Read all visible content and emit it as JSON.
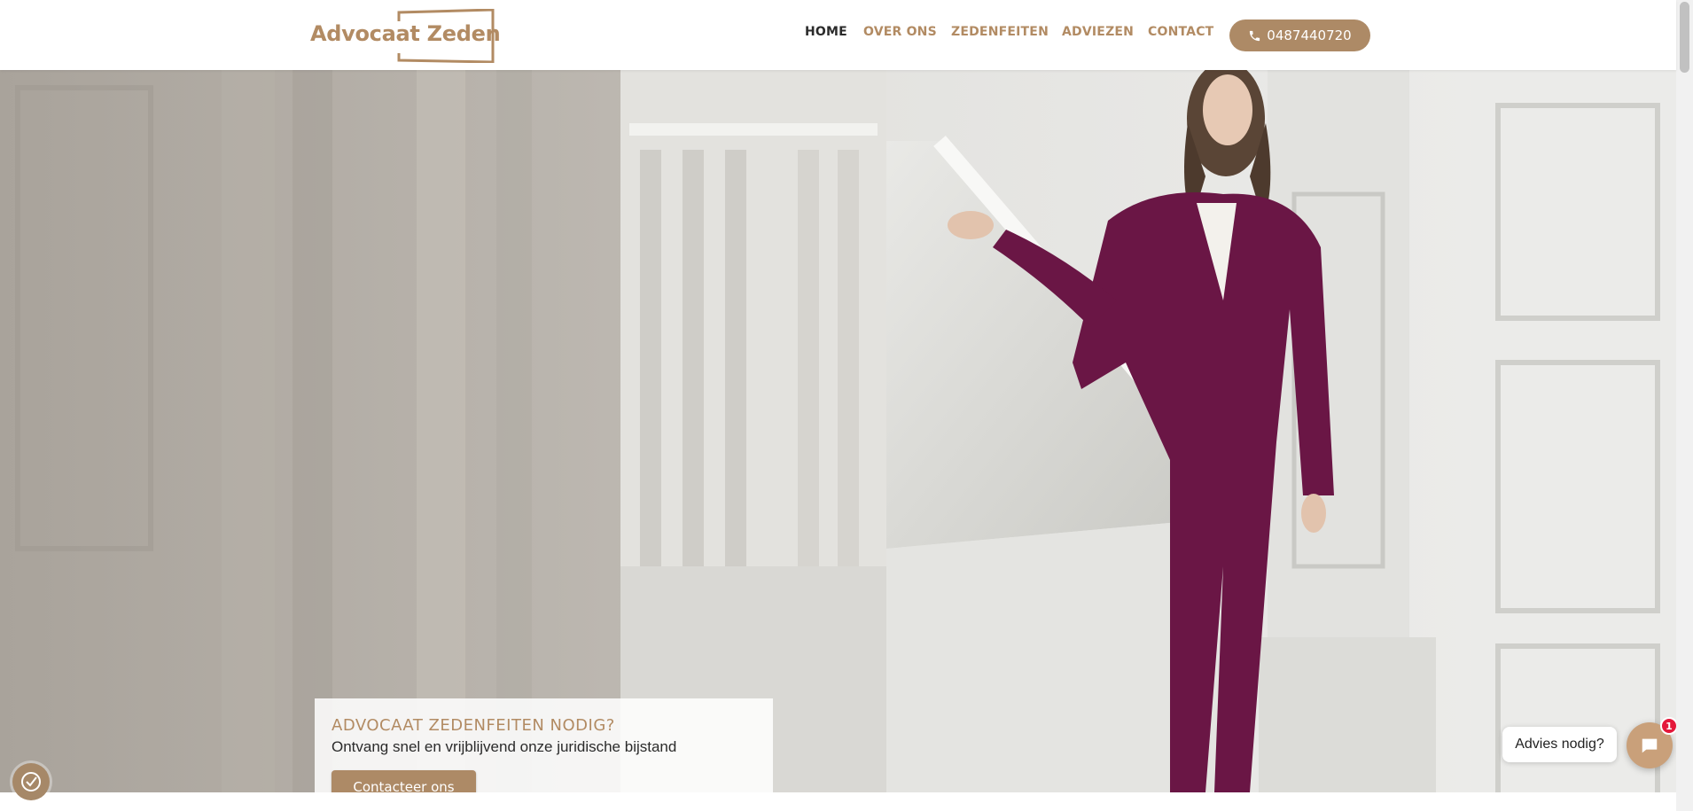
{
  "brand": {
    "logo_text": "Advocaat Zeden",
    "accent_color": "#b28b63"
  },
  "nav": {
    "items": [
      {
        "label": "HOME",
        "active": true
      },
      {
        "label": "OVER ONS",
        "active": false
      },
      {
        "label": "ZEDENFEITEN",
        "active": false
      },
      {
        "label": "ADVIEZEN",
        "active": false
      },
      {
        "label": "CONTACT",
        "active": false
      }
    ],
    "phone_label": "0487440720",
    "phone_icon": "phone-icon"
  },
  "hero": {
    "title": "ADVOCAAT ZEDENFEITEN NODIG?",
    "subtitle": "Ontvang snel en vrijblijvend onze juridische bijstand",
    "button_label": "Contacteer ons"
  },
  "cookie": {
    "icon": "cookie-settings-icon"
  },
  "chat": {
    "bubble_text": "Advies nodig?",
    "badge_count": "1",
    "icon": "chat-icon"
  }
}
